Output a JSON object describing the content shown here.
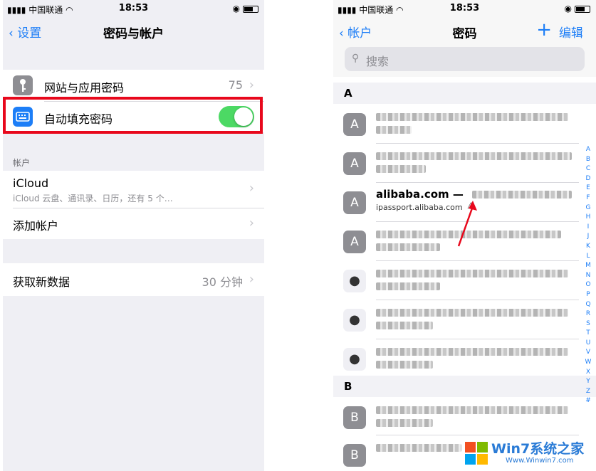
{
  "left": {
    "status": {
      "carrier": "中国联通",
      "time": "18:53"
    },
    "nav": {
      "back": "设置",
      "title": "密码与帐户"
    },
    "rows": {
      "passwords": {
        "label": "网站与应用密码",
        "value": "75"
      },
      "autofill": {
        "label": "自动填充密码",
        "toggle": "on"
      }
    },
    "section_accounts": "帐户",
    "icloud": {
      "label": "iCloud",
      "sub": "iCloud 云盘、通讯录、日历，还有 5 个…"
    },
    "add_account": "添加帐户",
    "fetch": {
      "label": "获取新数据",
      "value": "30 分钟"
    }
  },
  "right": {
    "status": {
      "carrier": "中国联通",
      "time": "18:53"
    },
    "nav": {
      "back": "帐户",
      "title": "密码",
      "add": "+",
      "edit": "编辑"
    },
    "search_placeholder": "搜索",
    "section_a": "A",
    "section_b": "B",
    "highlighted": {
      "site": "alibaba.com —",
      "domain": "ipassport.alibaba.com",
      "warning": "⚠"
    },
    "avatar_a": "A",
    "avatar_b": "B",
    "index": [
      "A",
      "B",
      "C",
      "D",
      "E",
      "F",
      "G",
      "H",
      "I",
      "J",
      "K",
      "L",
      "M",
      "N",
      "O",
      "P",
      "Q",
      "R",
      "S",
      "T",
      "U",
      "V",
      "W",
      "X",
      "Y",
      "Z",
      "#"
    ]
  },
  "watermark": {
    "text": "Win7系统之家",
    "url": "Www.Winwin7.com"
  },
  "colors": {
    "accent": "#1d7ef7",
    "toggle": "#4cd964",
    "highlight": "#e8081c"
  }
}
